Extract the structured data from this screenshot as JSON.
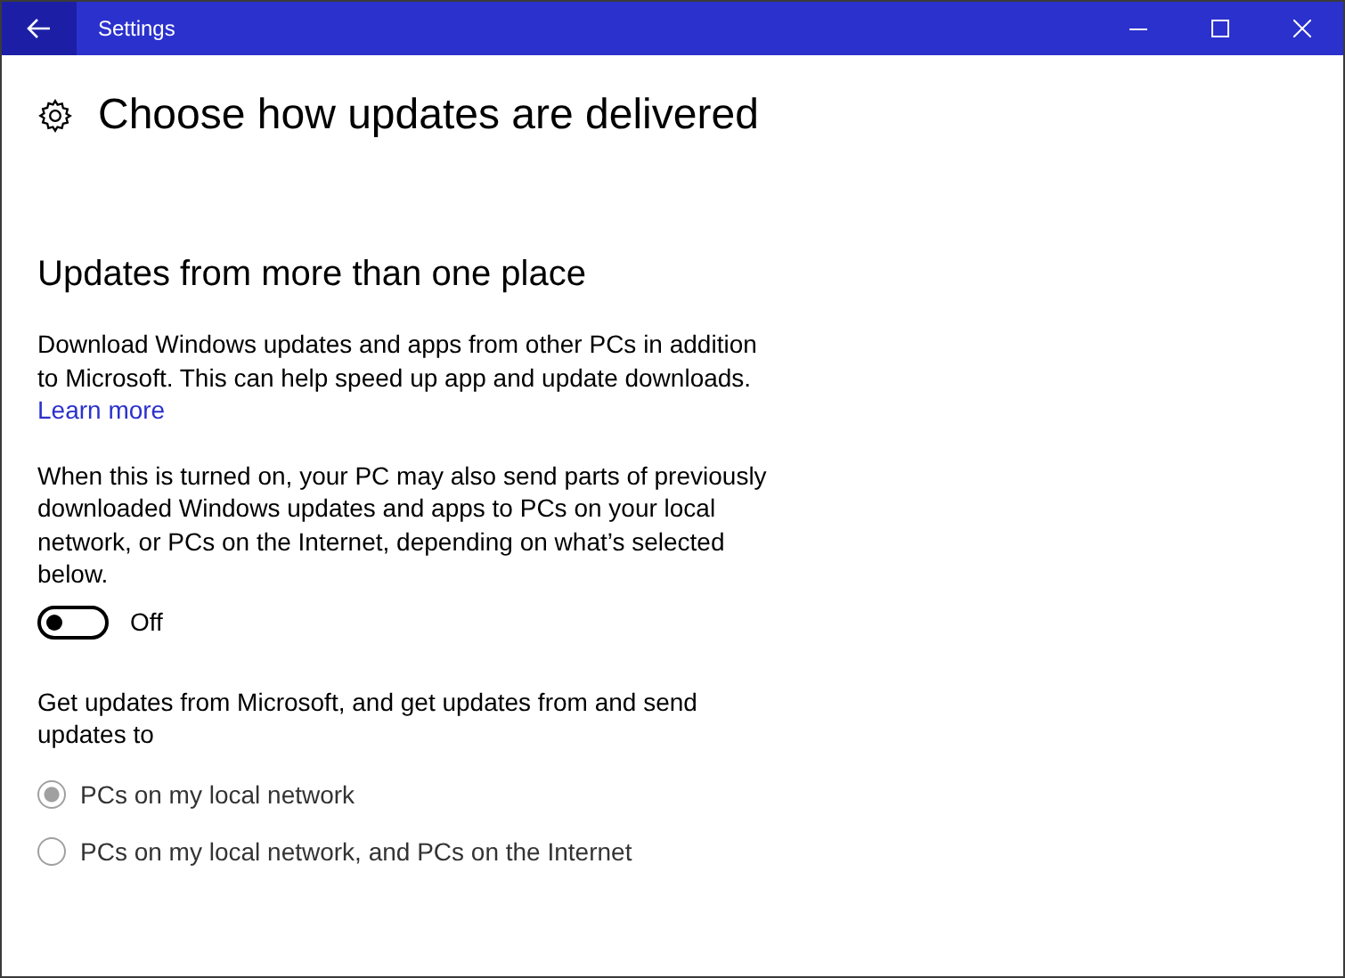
{
  "window": {
    "title": "Settings"
  },
  "page": {
    "title": "Choose how updates are delivered"
  },
  "section": {
    "heading": "Updates from more than one place",
    "description": "Download Windows updates and apps from other PCs in addition to Microsoft. This can help speed up app and update downloads.",
    "link": "Learn more",
    "note": "When this is turned on, your PC may also send parts of previously downloaded Windows updates and apps to PCs on your local network, or PCs on the Internet, depending on what’s selected below.",
    "toggle": {
      "on": false,
      "label": "Off"
    },
    "options_label": "Get updates from Microsoft, and get updates from and send updates to",
    "options": [
      {
        "label": "PCs on my local network",
        "selected": true,
        "disabled": true
      },
      {
        "label": "PCs on my local network, and PCs on the Internet",
        "selected": false,
        "disabled": true
      }
    ]
  }
}
